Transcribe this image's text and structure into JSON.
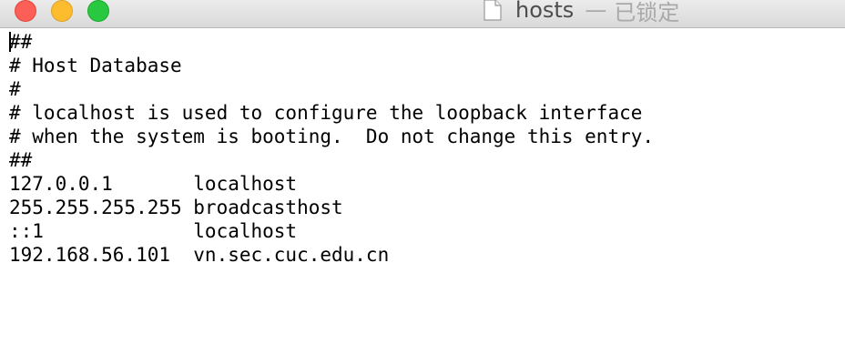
{
  "window": {
    "title": "hosts",
    "separator": "—",
    "status": "已锁定",
    "doc_icon": "document-icon",
    "traffic_lights": {
      "close_color": "#fc5f57",
      "minimize_color": "#fdbc2e",
      "zoom_color": "#28c840"
    }
  },
  "editor": {
    "lines": [
      "##",
      "# Host Database",
      "#",
      "# localhost is used to configure the loopback interface",
      "# when the system is booting.  Do not change this entry.",
      "##",
      "127.0.0.1       localhost",
      "255.255.255.255 broadcasthost",
      "::1             localhost",
      "192.168.56.101  vn.sec.cuc.edu.cn"
    ]
  }
}
